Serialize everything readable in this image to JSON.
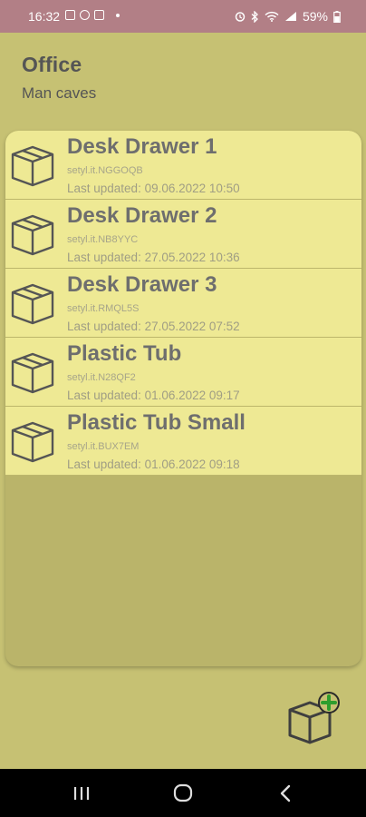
{
  "status": {
    "time": "16:32",
    "battery": "59%"
  },
  "header": {
    "title": "Office",
    "subtitle": "Man caves"
  },
  "items": [
    {
      "name": "Desk Drawer 1",
      "code": "setyl.it.NGGOQB",
      "updated": "Last updated: 09.06.2022 10:50"
    },
    {
      "name": "Desk Drawer 2",
      "code": "setyl.it.NB8YYC",
      "updated": "Last updated: 27.05.2022 10:36"
    },
    {
      "name": "Desk Drawer 3",
      "code": "setyl.it.RMQL5S",
      "updated": "Last updated: 27.05.2022 07:52"
    },
    {
      "name": "Plastic Tub",
      "code": "setyl.it.N28QF2",
      "updated": "Last updated: 01.06.2022 09:17"
    },
    {
      "name": "Plastic Tub Small",
      "code": "setyl.it.BUX7EM",
      "updated": "Last updated: 01.06.2022 09:18"
    }
  ],
  "colors": {
    "background": "#c6c173",
    "item_background": "#eee994",
    "status_bar": "#b27f86",
    "add_accent": "#2e9e2e"
  },
  "icons": {
    "item": "box-icon",
    "fab": "add-box-icon",
    "nav": [
      "recent-apps-icon",
      "home-icon",
      "back-icon"
    ]
  }
}
